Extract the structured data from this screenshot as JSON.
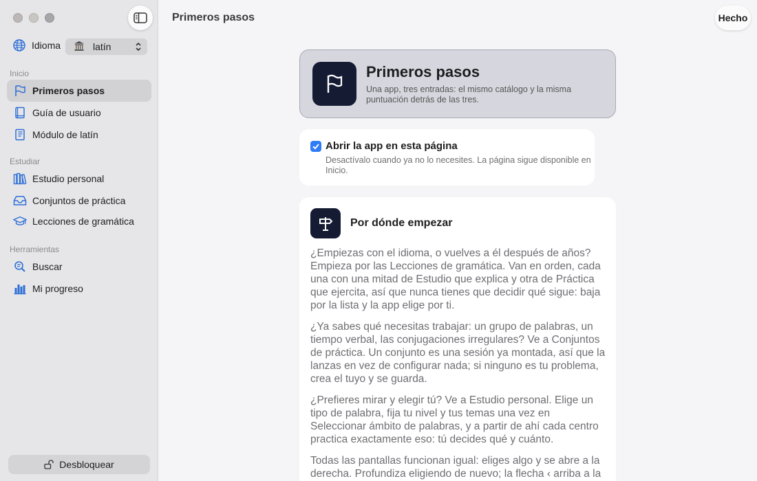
{
  "window": {
    "title": "Primeros pasos",
    "done_label": "Hecho"
  },
  "sidebar": {
    "language": {
      "label": "Idioma",
      "value": "latín",
      "flag_icon": "columns-building-icon"
    },
    "sections": [
      {
        "title": "Inicio",
        "items": [
          {
            "label": "Primeros pasos",
            "icon": "flag-icon",
            "active": true
          },
          {
            "label": "Guía de usuario",
            "icon": "book-icon"
          },
          {
            "label": "Módulo de latín",
            "icon": "book-closed-icon"
          }
        ]
      },
      {
        "title": "Estudiar",
        "items": [
          {
            "label": "Estudio personal",
            "icon": "books-icon"
          },
          {
            "label": "Conjuntos de práctica",
            "icon": "tray-icon"
          },
          {
            "label": "Lecciones de gramática",
            "icon": "graduation-cap-icon"
          }
        ]
      },
      {
        "title": "Herramientas",
        "items": [
          {
            "label": "Buscar",
            "icon": "search-icon"
          },
          {
            "label": "Mi progreso",
            "icon": "bar-chart-icon"
          }
        ]
      }
    ],
    "unlock_label": "Desbloquear"
  },
  "hero": {
    "title": "Primeros pasos",
    "subtitle": "Una app, tres entradas: el mismo catálogo y la misma puntuación detrás de las tres."
  },
  "optin": {
    "checked": true,
    "title": "Abrir la app en esta página",
    "subtitle": "Desactívalo cuando ya no lo necesites. La página sigue disponible en Inicio."
  },
  "guide": {
    "title": "Por dónde empezar",
    "paragraphs": [
      "¿Empiezas con el idioma, o vuelves a él después de años? Empieza por las Lecciones de gramática. Van en orden, cada una con una mitad de Estudio que explica y otra de Práctica que ejercita, así que nunca tienes que decidir qué sigue: baja por la lista y la app elige por ti.",
      "¿Ya sabes qué necesitas trabajar: un grupo de palabras, un tiempo verbal, las conjugaciones irregulares? Ve a Conjuntos de práctica. Un conjunto es una sesión ya montada, así que la lanzas en vez de configurar nada; si ninguno es tu problema, crea el tuyo y se guarda.",
      "¿Prefieres mirar y elegir tú? Ve a Estudio personal. Elige un tipo de palabra, fija tu nivel y tus temas una vez en Seleccionar ámbito de palabras, y a partir de ahí cada centro practica exactamente eso: tú decides qué y cuánto.",
      "Todas las pantallas funcionan igual: eliges algo y se abre a la derecha. Profundiza eligiendo de nuevo; la flecha ‹ arriba a la"
    ]
  }
}
